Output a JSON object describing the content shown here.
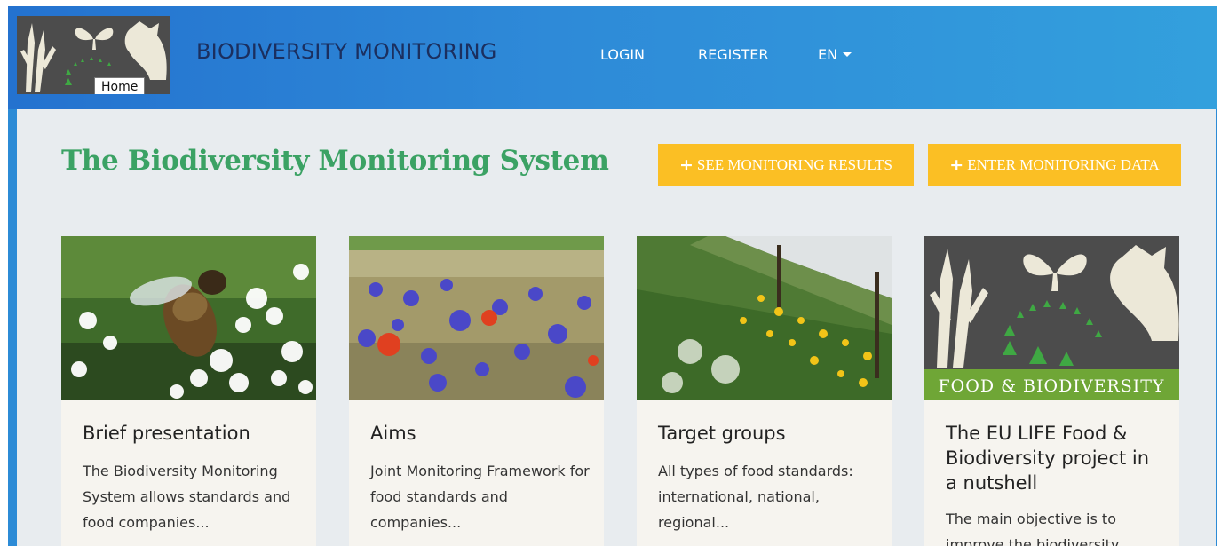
{
  "navbar": {
    "logo_tooltip": "Home",
    "brand": "BIODIVERSITY MONITORING",
    "links": {
      "login": "LOGIN",
      "register": "REGISTER",
      "language": "EN"
    }
  },
  "hero": {
    "title": "The Biodiversity Monitoring System",
    "see_results": "SEE MONITORING RESULTS",
    "enter_data": "ENTER MONITORING DATA"
  },
  "cards": [
    {
      "image": "bee-on-white-flowers",
      "title": "Brief presentation",
      "text": "The Biodiversity Monitoring System allows standards and food companies..."
    },
    {
      "image": "wildflower-field",
      "title": "Aims",
      "text": "Joint Monitoring Framework for food standards and companies..."
    },
    {
      "image": "greenhouse-flower-strip",
      "title": "Target groups",
      "text": "All types of food standards: international, national, regional..."
    },
    {
      "image": "food-and-biodiversity-logo",
      "title": "The EU LIFE Food & Biodiversity project in a nutshell",
      "text": "The main objective is to improve the biodiversity",
      "logo_text": "FOOD & BIODIVERSITY"
    }
  ],
  "colors": {
    "nav_start": "#2472cf",
    "nav_end": "#33a0dd",
    "brand_text": "#1b2f5f",
    "title_green": "#3ba264",
    "button_yellow": "#fbbf24",
    "panel": "#e8ecef",
    "card": "#f6f4ef"
  }
}
